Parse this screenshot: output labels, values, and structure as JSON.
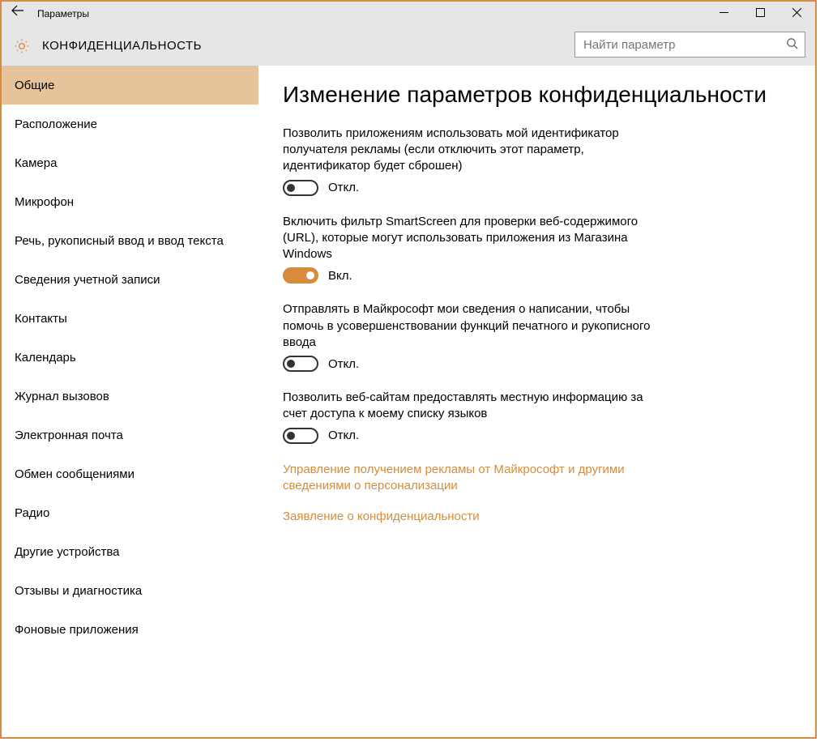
{
  "window": {
    "title": "Параметры"
  },
  "header": {
    "category": "КОНФИДЕНЦИАЛЬНОСТЬ",
    "search_placeholder": "Найти параметр"
  },
  "sidebar": {
    "items": [
      "Общие",
      "Расположение",
      "Камера",
      "Микрофон",
      "Речь, рукописный ввод и ввод текста",
      "Сведения учетной записи",
      "Контакты",
      "Календарь",
      "Журнал вызовов",
      "Электронная почта",
      "Обмен сообщениями",
      "Радио",
      "Другие устройства",
      "Отзывы и диагностика",
      "Фоновые приложения"
    ],
    "selected_index": 0
  },
  "main": {
    "heading": "Изменение параметров конфиденциальности",
    "settings": [
      {
        "desc": "Позволить приложениям использовать мой идентификатор получателя рекламы (если отключить этот параметр, идентификатор будет сброшен)",
        "on": false,
        "label": "Откл."
      },
      {
        "desc": "Включить фильтр SmartScreen для проверки веб-содержимого (URL), которые могут использовать приложения из Магазина Windows",
        "on": true,
        "label": "Вкл."
      },
      {
        "desc": "Отправлять в Майкрософт мои сведения о написании, чтобы помочь в усовершенствовании функций печатного и рукописного ввода",
        "on": false,
        "label": "Откл."
      },
      {
        "desc": "Позволить веб-сайтам предоставлять местную информацию за счет доступа к моему списку языков",
        "on": false,
        "label": "Откл."
      }
    ],
    "links": [
      "Управление получением рекламы от Майкрософт и другими сведениями о персонализации",
      "Заявление о конфиденциальности"
    ]
  },
  "colors": {
    "accent": "#d68c3c",
    "selected_bg": "#e7c39c",
    "chrome_bg": "#e6e6e6"
  }
}
